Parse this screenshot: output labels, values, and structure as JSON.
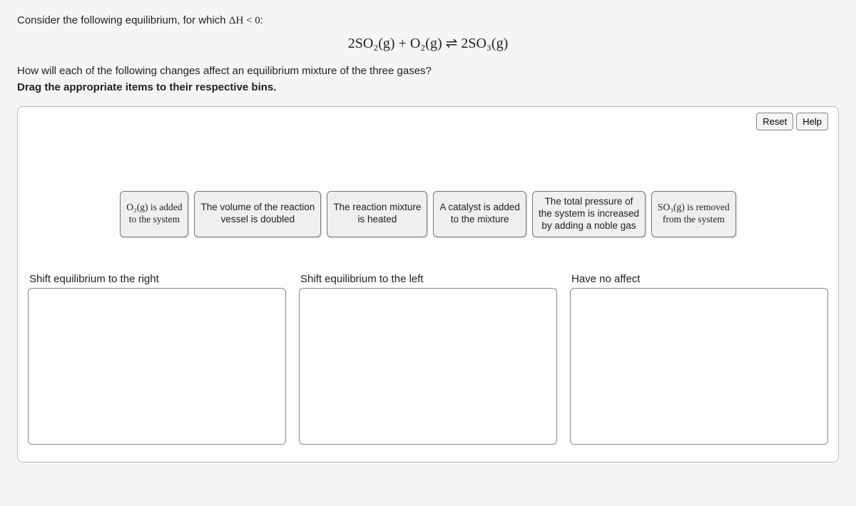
{
  "intro": {
    "text_before": "Consider the following equilibrium, for which ",
    "delta_html": "ΔH < 0",
    "text_after": ":"
  },
  "equation": {
    "lhs_a": "2SO₂(g)",
    "plus": " + ",
    "lhs_b": "O₂(g)",
    "arrow": " ⇌ ",
    "rhs": "2SO₃(g)"
  },
  "question2": "How will each of the following changes affect an equilibrium mixture of the three gases?",
  "instruction": "Drag the appropriate items to their respective bins.",
  "buttons": {
    "reset": "Reset",
    "help": "Help"
  },
  "items": [
    {
      "html": "O₂(g) is added<br>to the system",
      "name": "item-o2-added"
    },
    {
      "html": "The volume of the reaction<br>vessel is doubled",
      "name": "item-volume-doubled"
    },
    {
      "html": "The reaction mixture<br>is heated",
      "name": "item-heated"
    },
    {
      "html": "A catalyst is added<br>to the mixture",
      "name": "item-catalyst"
    },
    {
      "html": "The total pressure of<br>the system is increased<br>by adding a noble gas",
      "name": "item-noble-gas"
    },
    {
      "html": "SO₃(g) is removed<br>from the system",
      "name": "item-so3-removed"
    }
  ],
  "bins": [
    {
      "label": "Shift equilibrium to the right",
      "name": "bin-shift-right"
    },
    {
      "label": "Shift equilibrium to the left",
      "name": "bin-shift-left"
    },
    {
      "label": "Have no affect",
      "name": "bin-no-affect"
    }
  ]
}
